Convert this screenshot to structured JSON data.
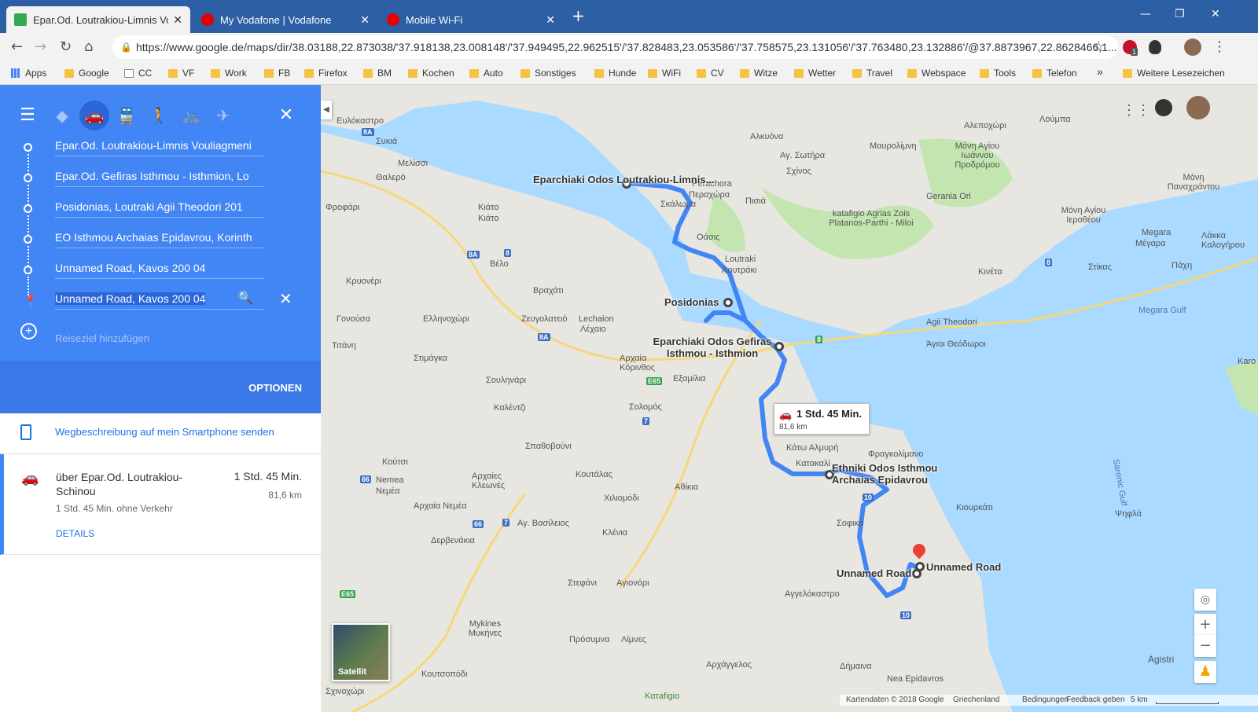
{
  "browser": {
    "tabs": [
      {
        "title": "Epar.Od. Loutrakiou-Limnis Vouli",
        "active": true
      },
      {
        "title": "My Vodafone | Vodafone",
        "active": false
      },
      {
        "title": "Mobile Wi-Fi",
        "active": false
      }
    ],
    "url": "https://www.google.de/maps/dir/38.03188,22.873038/'37.918138,23.008148'/'37.949495,22.962515'/'37.828483,23.053586'/'37.758575,23.131056'/'37.763480,23.132886'/@37.8873967,22.8628466,1...",
    "bookmarks": [
      "Apps",
      "Google",
      "CC",
      "VF",
      "Work",
      "FB",
      "Firefox",
      "BM",
      "Kochen",
      "Auto",
      "Sonstiges",
      "Hunde",
      "WiFi",
      "CV",
      "Witze",
      "Wetter",
      "Travel",
      "Webspace",
      "Tools",
      "Telefon",
      "»",
      "Weitere Lesezeichen"
    ],
    "ext_badge": "1"
  },
  "directions": {
    "waypoints": [
      "Epar.Od. Loutrakiou-Limnis Vouliagmeni",
      "Epar.Od. Gefiras Isthmou - Isthmion, Lo",
      "Posidonias, Loutraki Agii Theodori 201",
      "EO Isthmou Archaias Epidavrou, Korinth",
      "Unnamed Road, Kavos 200 04",
      "Unnamed Road, Kavos 200 04"
    ],
    "add_destination": "Reiseziel hinzufügen",
    "options": "OPTIONEN",
    "send_to_phone": "Wegbeschreibung auf mein Smartphone senden",
    "route": {
      "via": "über Epar.Od. Loutrakiou-Schinou",
      "duration": "1 Std. 45 Min.",
      "distance": "81,6 km",
      "traffic_note": "1 Std. 45 Min. ohne Verkehr",
      "details": "DETAILS"
    }
  },
  "map": {
    "route_box": {
      "duration": "1 Std. 45 Min.",
      "distance": "81,6 km"
    },
    "place_labels": [
      "Eparchiaki Odos Loutrakiou-Limnis...",
      "Posidonias",
      "Eparchiaki Odos Gefiras Isthmou - Isthmion",
      "Ethniki Odos Isthmou Archaias Epidavrou",
      "Unnamed Road",
      "Unnamed Road"
    ],
    "towns": [
      "Ευλόκαστρο",
      "Συκιά",
      "Θαλερό",
      "Μελίσσι",
      "Φροφάρι",
      "Κιάτο",
      "Κιάτο",
      "Βέλο",
      "Κρυονέρι",
      "Βραχάτι",
      "Γονούσα",
      "Ελληνοχώρι",
      "Ζευγολατειό",
      "Lechaion",
      "Λέχαιο",
      "Τιτάνη",
      "Στιμάγκα",
      "Σουληνάρι",
      "Αρχαία Κόρινθος",
      "Εξαμίλια",
      "Καλέντζι",
      "Σολομός",
      "Κούτσι",
      "Σπαθοβούνι",
      "Nemea",
      "Νεμέα",
      "Αρχαίες Κλεωνές",
      "Κουτάλας",
      "Χιλιομόδι",
      "Αθίκια",
      "Αρχαία Νεμέα",
      "Αγ. Βασίλειος",
      "Δερβενάκια",
      "Κλένια",
      "Στεφάνι",
      "Αγιονόρι",
      "Mykines Μυκήνες",
      "Πρόσυμνα",
      "Λίμνες",
      "Αρχάγγελος",
      "Κουτσοπόδι",
      "Σχινοχώρι",
      "Αλκυόνα",
      "Αγ. Σωτήρα",
      "Σχίνος",
      "Perachora",
      "Περαχώρα",
      "Σκάλωμα",
      "Πισιά",
      "Οάσις",
      "Loutraki",
      "Λουτράκι",
      "katafigio Agrias Zois Platanos-Parthi - Miloi",
      "Geraniа Ori",
      "Agii Theodori",
      "Άγιοι Θεόδωροι",
      "Κινέτα",
      "Στίκας",
      "Megara",
      "Μέγαρα",
      "Μαυρολίμνη",
      "Μόνη Αγίου Ιωάννου Προδρόμου",
      "Μόνη Παναχράντου",
      "Μόνη Αγίου Ιεροθέου",
      "Αλεποχώρι",
      "Λούμπα",
      "Λάκκα Καλογήρου",
      "Πάχη",
      "Megara Gulf",
      "Κάτω Αλμυρή",
      "Κατακαλί",
      "Φραγκολίμανο",
      "Σοφικό",
      "Κιουρκάτι",
      "Αγγελόκαστρο",
      "Saronic Gulf",
      "Ψηφλά",
      "Δήμαινα",
      "Nea Epidavros",
      "Agistri",
      "Κατafigio",
      "Karo"
    ],
    "road_numbers": [
      "8A",
      "8A",
      "8",
      "8A",
      "E65",
      "7",
      "66",
      "66",
      "7",
      "8",
      "8",
      "10",
      "10",
      "E65"
    ],
    "satellite": "Satellit",
    "footer": [
      "Kartendaten © 2018 Google",
      "Griechenland",
      "Bedingungen",
      "Feedback geben",
      "5 km"
    ],
    "colors": {
      "route": "#4285f4",
      "water": "#aadaff",
      "land": "#e7e6e1",
      "park": "#c3e6b0",
      "panel": "#4285f4"
    }
  }
}
